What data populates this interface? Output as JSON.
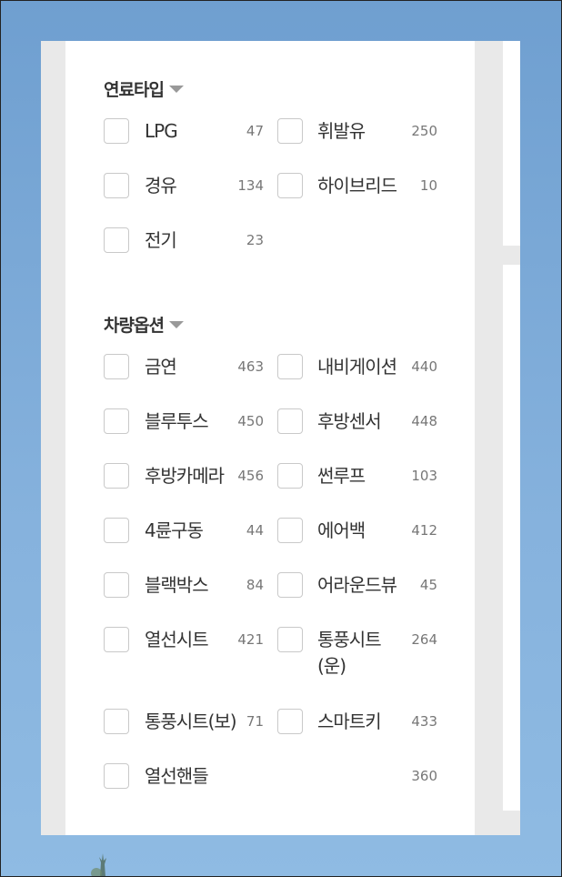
{
  "sections": [
    {
      "title": "연료타입",
      "options": [
        {
          "label": "LPG",
          "count": "47"
        },
        {
          "label": "휘발유",
          "count": "250"
        },
        {
          "label": "경유",
          "count": "134"
        },
        {
          "label": "하이브리드",
          "count": "10"
        },
        {
          "label": "전기",
          "count": "23"
        }
      ]
    },
    {
      "title": "차량옵션",
      "options": [
        {
          "label": "금연",
          "count": "463"
        },
        {
          "label": "내비게이션",
          "count": "440"
        },
        {
          "label": "블루투스",
          "count": "450"
        },
        {
          "label": "후방센서",
          "count": "448"
        },
        {
          "label": "후방카메라",
          "count": "456"
        },
        {
          "label": "썬루프",
          "count": "103"
        },
        {
          "label": "4륜구동",
          "count": "44"
        },
        {
          "label": "에어백",
          "count": "412"
        },
        {
          "label": "블랙박스",
          "count": "84"
        },
        {
          "label": "어라운드뷰",
          "count": "45"
        },
        {
          "label": "열선시트",
          "count": "421"
        },
        {
          "label": "통풍시트",
          "label_line2": "(운)",
          "count": "264"
        },
        {
          "label": "통풍시트(보)",
          "count": "71"
        },
        {
          "label": "스마트키",
          "count": "433"
        },
        {
          "label": "열선핸들",
          "count": "360"
        }
      ]
    }
  ],
  "icons": {
    "dropdown": "caret-down-icon",
    "checkbox": "checkbox-icon"
  }
}
